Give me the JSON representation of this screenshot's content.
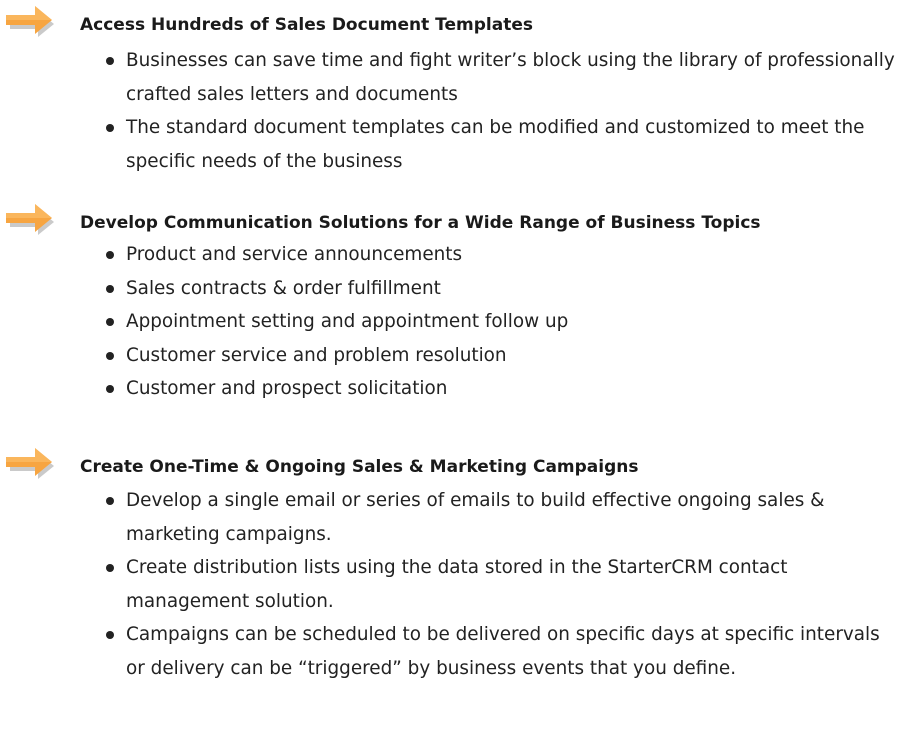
{
  "sections": [
    {
      "icon": "orange-arrow-icon",
      "heading": "Access Hundreds of Sales Document Templates",
      "bullets": [
        "Businesses can save time and fight writer’s block using the library of professionally crafted sales letters and documents",
        "The standard document templates can be modified and customized to meet the specific needs of the business"
      ]
    },
    {
      "icon": "orange-arrow-icon",
      "heading": "Develop Communication Solutions for a Wide Range of Business Topics",
      "bullets": [
        "Product and service announcements",
        "Sales contracts & order fulfillment",
        "Appointment setting and appointment follow up",
        "Customer service and problem resolution",
        "Customer and prospect solicitation"
      ]
    },
    {
      "icon": "orange-arrow-icon",
      "heading": "Create One-Time & Ongoing Sales & Marketing Campaigns",
      "bullets": [
        "Develop a single email or series of emails to build effective ongoing sales & marketing campaigns.",
        "Create distribution lists using the data stored in the StarterCRM contact management solution.",
        "Campaigns can be scheduled to be delivered on specific days at specific intervals or delivery can be “triggered” by business events that you define."
      ]
    }
  ],
  "colors": {
    "arrow_fill": "#F7A541",
    "arrow_shadow": "#B8B8B8",
    "text": "#222222"
  }
}
